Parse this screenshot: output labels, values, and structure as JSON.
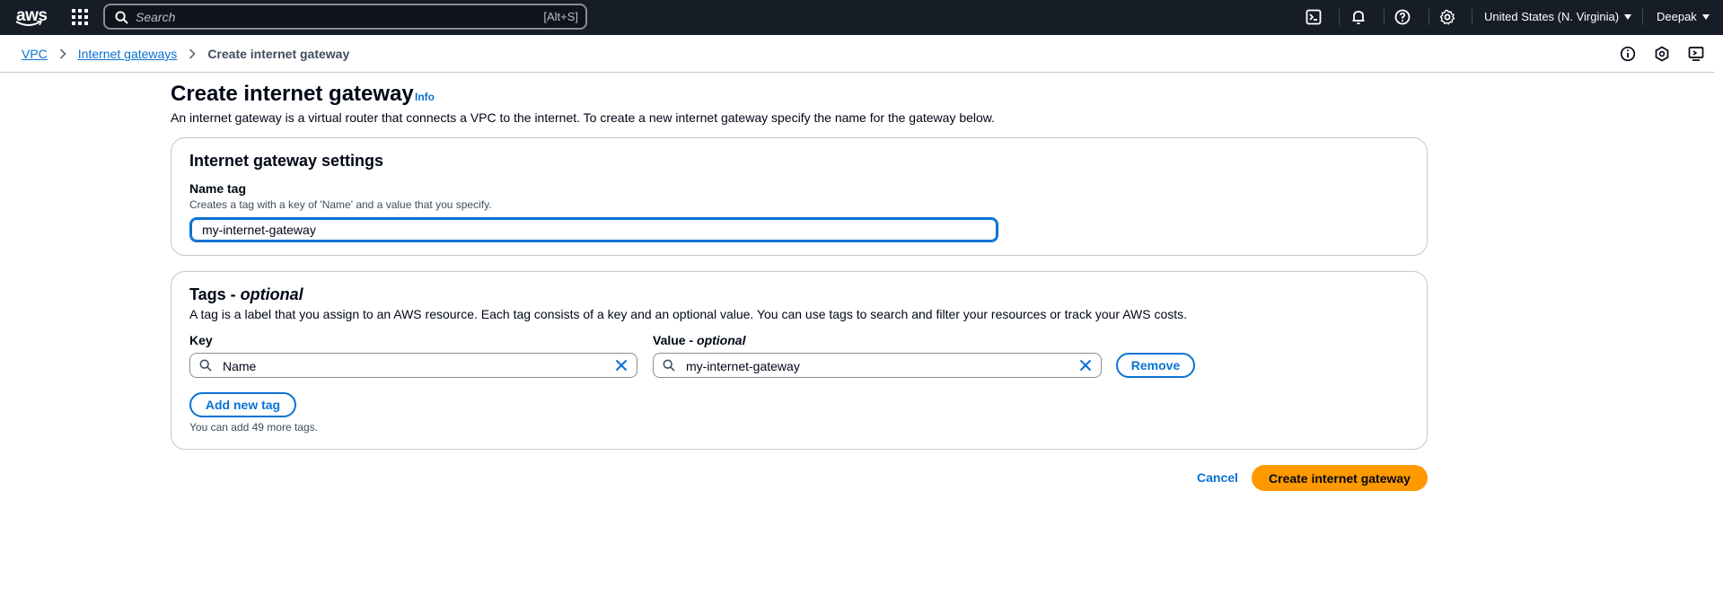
{
  "topnav": {
    "logo_text": "aws",
    "search_placeholder": "Search",
    "search_shortcut": "[Alt+S]",
    "region": "United States (N. Virginia)",
    "user": "Deepak",
    "icons": [
      "services-grid-icon",
      "cloudshell-icon",
      "notifications-bell-icon",
      "help-icon",
      "settings-gear-icon"
    ]
  },
  "breadcrumb": {
    "items": [
      "VPC",
      "Internet gateways"
    ],
    "current": "Create internet gateway"
  },
  "page": {
    "title": "Create internet gateway",
    "info": "Info",
    "description": "An internet gateway is a virtual router that connects a VPC to the internet. To create a new internet gateway specify the name for the gateway below."
  },
  "settings": {
    "title": "Internet gateway settings",
    "name_label": "Name tag",
    "name_desc": "Creates a tag with a key of 'Name' and a value that you specify.",
    "name_value": "my-internet-gateway"
  },
  "tags": {
    "title": "Tags - ",
    "title_optional": "optional",
    "description": "A tag is a label that you assign to an AWS resource. Each tag consists of a key and an optional value. You can use tags to search and filter your resources or track your AWS costs.",
    "key_label": "Key",
    "value_label": "Value - ",
    "value_label_optional": "optional",
    "rows": [
      {
        "key": "Name",
        "value": "my-internet-gateway"
      }
    ],
    "remove_label": "Remove",
    "add_label": "Add new tag",
    "hint": "You can add 49 more tags."
  },
  "footer": {
    "cancel": "Cancel",
    "submit": "Create internet gateway"
  },
  "colors": {
    "nav_bg": "#161d26",
    "link": "#0972d3",
    "primary_button": "#ff9900"
  }
}
